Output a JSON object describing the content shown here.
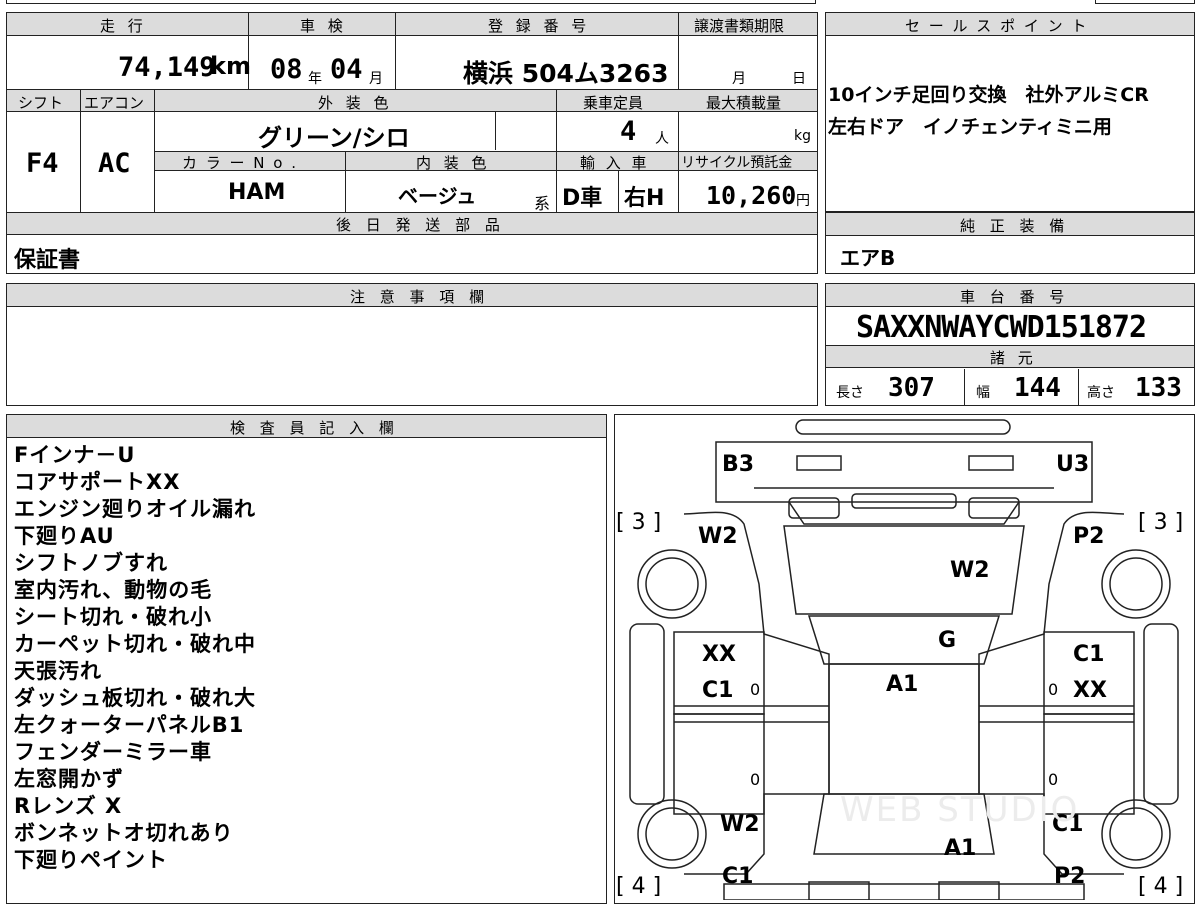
{
  "vehicle": {
    "mileage_label": "走 行",
    "mileage": "74,149",
    "mileage_unit": "km",
    "inspection_label": "車 検",
    "inspection_year": "08",
    "inspection_year_unit": "年",
    "inspection_month": "04",
    "inspection_month_unit": "月",
    "registration_label": "登 録 番 号",
    "registration": "横浜 504ム3263",
    "transfer_label": "譲渡書類期限",
    "transfer_month_unit": "月",
    "transfer_day_unit": "日",
    "shift_label": "シフト",
    "shift": "F4",
    "ac_label": "エアコン",
    "ac": "AC",
    "exterior_label": "外 装 色",
    "exterior": "グリーン/シロ",
    "capacity_label": "乗車定員",
    "capacity": "4",
    "capacity_unit": "人",
    "max_load_label": "最大積載量",
    "max_load_unit": "kg",
    "color_no_label": "カ ラ ー N o .",
    "color_no": "HAM",
    "interior_label": "内 装 色",
    "interior": "ベージュ",
    "interior_suffix": "系",
    "import_label": "輸 入 車",
    "import_type": "D車",
    "steering": "右H",
    "recycle_label": "リサイクル預託金",
    "recycle_fee": "10,260",
    "recycle_unit": "円",
    "later_parts_label": "後 日 発 送 部 品",
    "later_parts": "保証書"
  },
  "sales": {
    "label": "セ ー ル ス ポ イ ン ト",
    "lines": [
      "10インチ足回り交換　社外アルミCR",
      "左右ドア　イノチェンティミニ用"
    ]
  },
  "genuine": {
    "label": "純 正 装 備",
    "value": "エアB"
  },
  "caution": {
    "label": "注 意 事 項 欄"
  },
  "chassis": {
    "label": "車 台 番 号",
    "value": "SAXXNWAYCWD151872"
  },
  "specs": {
    "label": "諸 元",
    "length_label": "長さ",
    "length": "307",
    "width_label": "幅",
    "width": "144",
    "height_label": "高さ",
    "height": "133"
  },
  "inspector": {
    "label": "検 査 員 記 入 欄",
    "notes": [
      "Fインナ－U",
      "コアサポートXX",
      "エンジン廻りオイル漏れ",
      "下廻りAU",
      "シフトノブすれ",
      "室内汚れ、動物の毛",
      "シート切れ・破れ小",
      "カーペット切れ・破れ中",
      "天張汚れ",
      "ダッシュ板切れ・破れ大",
      "左クォーターパネルB1",
      "フェンダーミラー車",
      "左窓開かず",
      "Rレンズ X",
      "ボンネットオ切れあり",
      "下廻りペイント"
    ]
  },
  "diagram": {
    "tire_front_left": "[ 3 ]",
    "tire_front_right": "[ 3 ]",
    "tire_rear_left": "[ 4 ]",
    "tire_rear_right": "[ 4 ]",
    "front_bumper_left": "B3",
    "front_bumper_right": "U3",
    "fender_front_left": "W2",
    "fender_front_right": "P2",
    "bonnet": "W2",
    "windshield": "G",
    "door_left_1": "XX",
    "door_left_2": "C1",
    "door_right_1": "C1",
    "door_right_2": "XX",
    "roof": "A1",
    "fender_rear_left": "W2",
    "fender_rear_right": "C1",
    "rear": "A1",
    "rear_bumper_left": "C1",
    "rear_bumper_right": "P2",
    "small_zero": "0",
    "watermark": "WEB STUDIO"
  }
}
